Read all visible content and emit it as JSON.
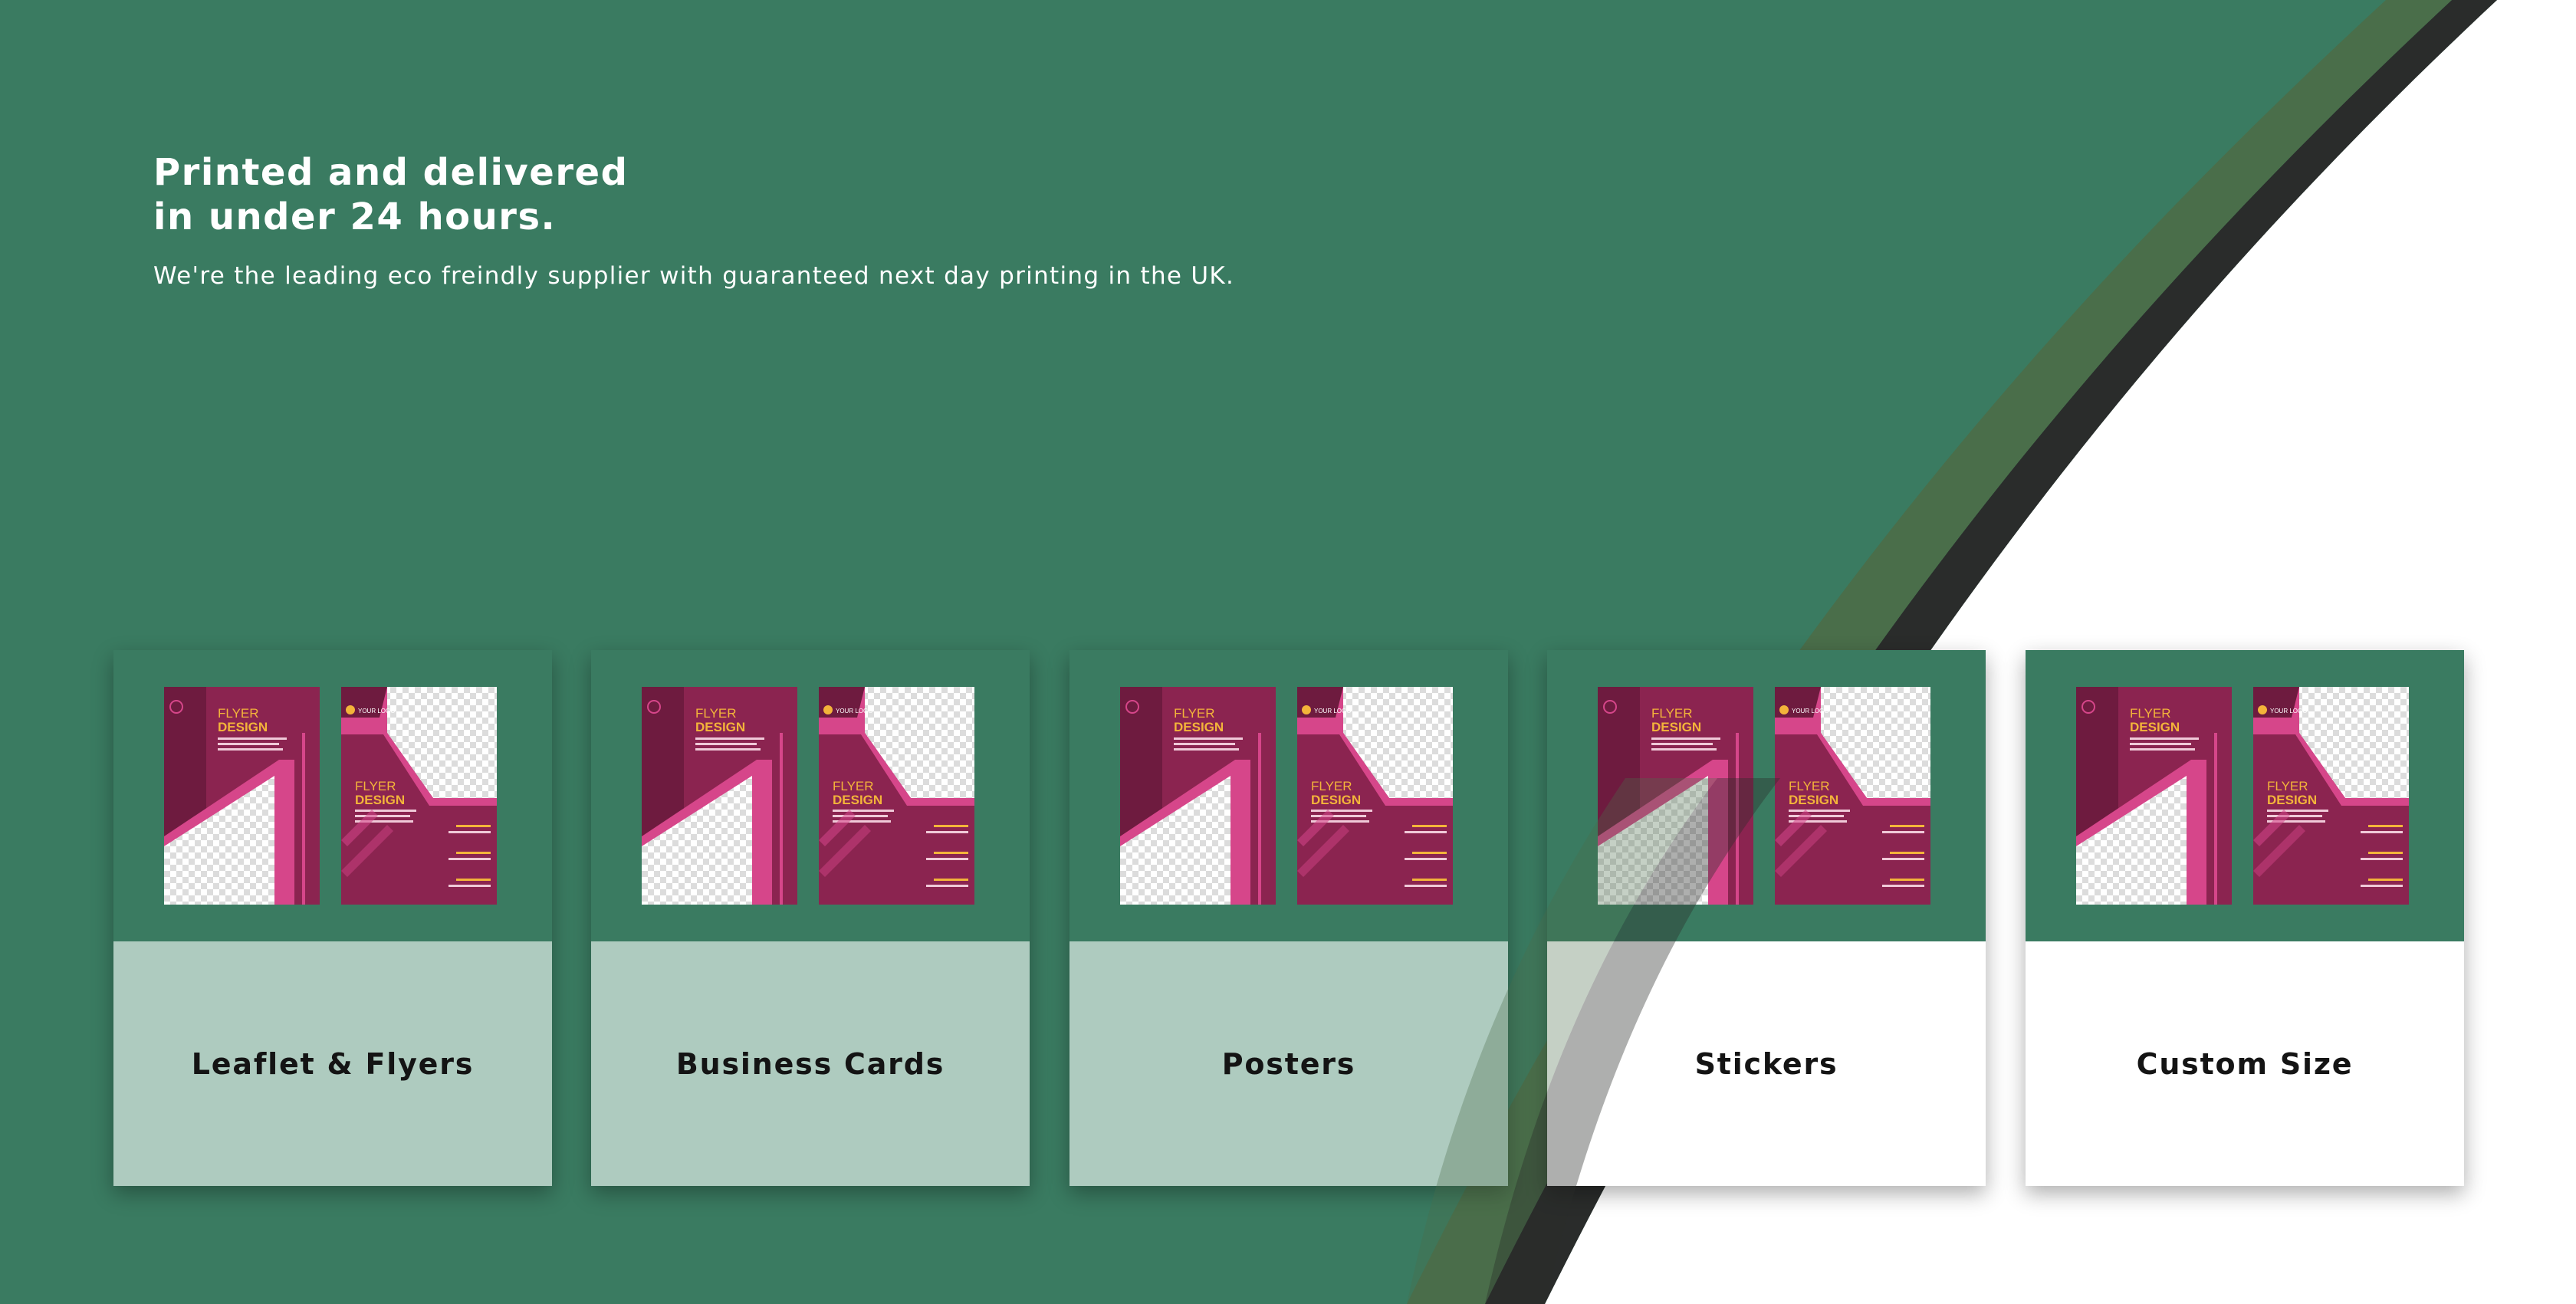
{
  "hero": {
    "title_line1": "Printed and delivered",
    "title_line2": "in under 24 hours.",
    "subtitle": "We're the leading eco freindly supplier with guaranteed next day printing in the UK."
  },
  "products": [
    {
      "label": "Leaflet & Flyers",
      "image": "flyer-design-mockup"
    },
    {
      "label": "Business Cards",
      "image": "flyer-design-mockup"
    },
    {
      "label": "Posters",
      "image": "flyer-design-mockup"
    },
    {
      "label": "Stickers",
      "image": "flyer-design-mockup"
    },
    {
      "label": "Custom Size",
      "image": "flyer-design-mockup"
    }
  ],
  "mockup": {
    "heading_line1": "FLYER",
    "heading_line2": "DESIGN",
    "logo_text": "YOUR LOGO"
  },
  "colors": {
    "brand_green": "#3a7b61",
    "card_tint": "#aecbbf",
    "stripe_dark": "#2a2c2b",
    "stripe_olive": "#4a6e4a",
    "flyer_magenta": "#8b2450",
    "flyer_accent": "#f3b43a"
  }
}
